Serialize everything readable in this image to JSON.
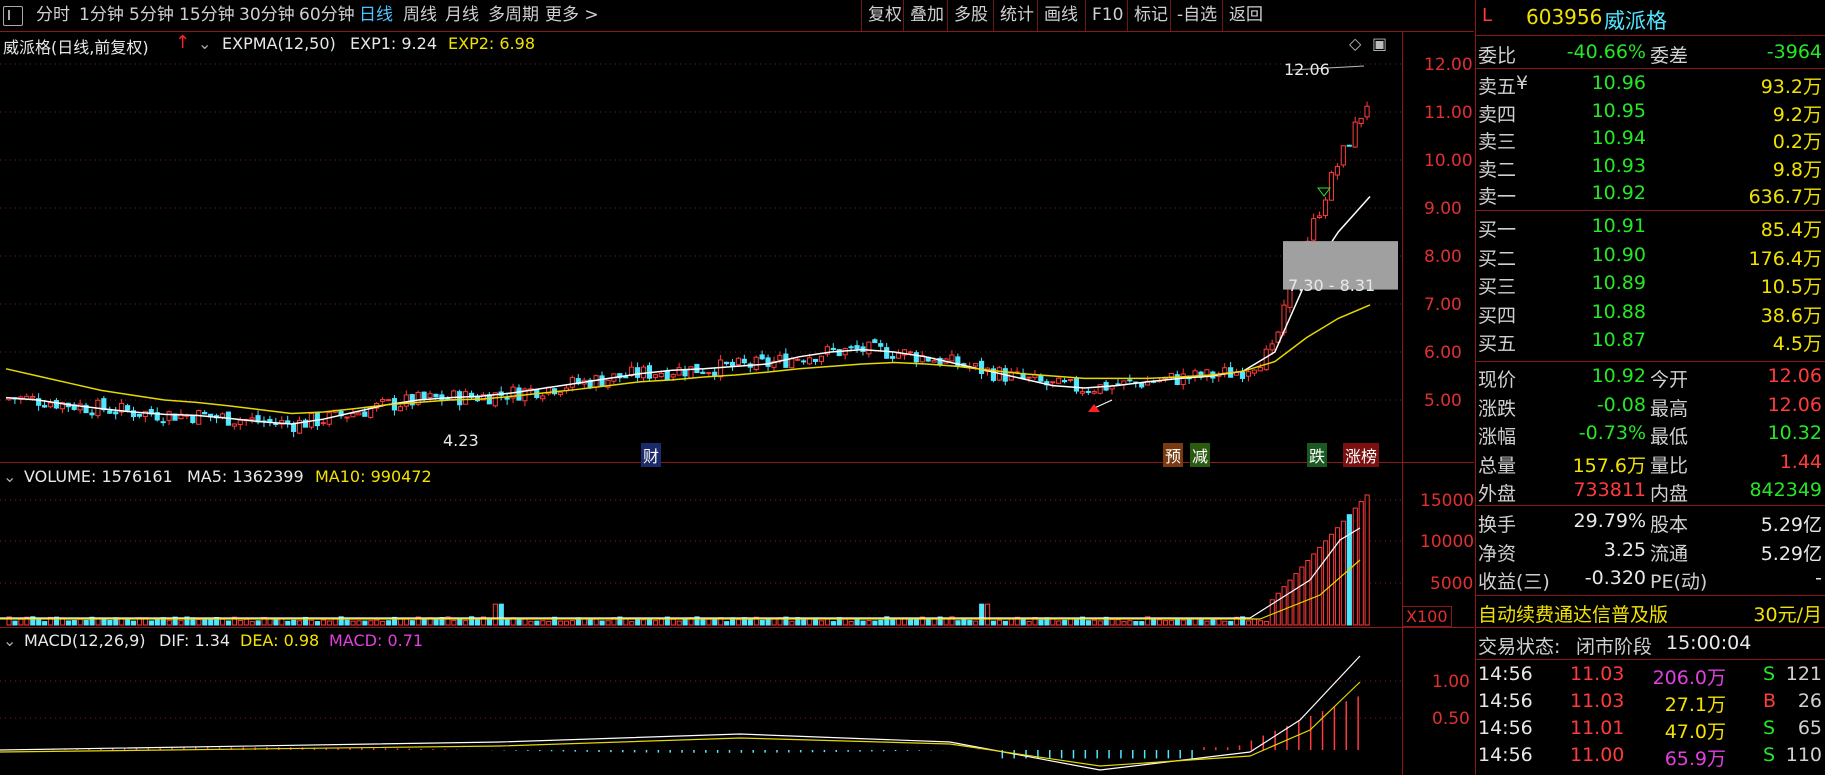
{
  "toolbar": {
    "periods": [
      "分时",
      "1分钟",
      "5分钟",
      "15分钟",
      "30分钟",
      "60分钟",
      "日线",
      "周线",
      "月线",
      "多周期",
      "更多 >"
    ],
    "active": "日线",
    "right_buttons": [
      "复权",
      "叠加",
      "多股",
      "统计",
      "画线",
      "F10",
      "标记",
      "-自选",
      "返回"
    ]
  },
  "main_chart": {
    "title": "威派格(日线,前复权)",
    "indicator": "EXPMA(12,50)",
    "exp1": "EXP1: 9.24",
    "exp2": "EXP2: 6.98",
    "y_ticks": [
      "12.00",
      "11.00",
      "10.00",
      "9.00",
      "8.00",
      "7.00",
      "6.00",
      "5.00"
    ],
    "high_label": "12.06",
    "low_label": "4.23",
    "range_label": "7.30 - 8.31",
    "events": [
      "财",
      "预",
      "减",
      "跌",
      "涨榜"
    ]
  },
  "volume_chart": {
    "label": "VOLUME: 1576161",
    "ma5": "MA5: 1362399",
    "ma10": "MA10: 990472",
    "y_ticks": [
      "15000",
      "10000",
      "5000"
    ],
    "unit": "X100"
  },
  "macd_chart": {
    "label": "MACD(12,26,9)",
    "dif": "DIF: 1.34",
    "dea": "DEA: 0.98",
    "macd": "MACD: 0.71",
    "y_ticks": [
      "1.00",
      "0.50"
    ]
  },
  "quote": {
    "code": "603956",
    "name": "威派格",
    "market_flag": "L",
    "weibi_label": "委比",
    "weibi": "-40.66%",
    "weicha_label": "委差",
    "weicha": "-3964",
    "asks": [
      {
        "label": "卖五",
        "price": "10.96",
        "vol": "93.2万"
      },
      {
        "label": "卖四",
        "price": "10.95",
        "vol": "9.2万"
      },
      {
        "label": "卖三",
        "price": "10.94",
        "vol": "0.2万"
      },
      {
        "label": "卖二",
        "price": "10.93",
        "vol": "9.8万"
      },
      {
        "label": "卖一",
        "price": "10.92",
        "vol": "636.7万"
      }
    ],
    "ask_currency": "¥",
    "bids": [
      {
        "label": "买一",
        "price": "10.91",
        "vol": "85.4万"
      },
      {
        "label": "买二",
        "price": "10.90",
        "vol": "176.4万"
      },
      {
        "label": "买三",
        "price": "10.89",
        "vol": "10.5万"
      },
      {
        "label": "买四",
        "price": "10.88",
        "vol": "38.6万"
      },
      {
        "label": "买五",
        "price": "10.87",
        "vol": "4.5万"
      }
    ],
    "stats": [
      {
        "l1": "现价",
        "v1": "10.92",
        "l2": "今开",
        "v2": "12.06"
      },
      {
        "l1": "涨跌",
        "v1": "-0.08",
        "l2": "最高",
        "v2": "12.06"
      },
      {
        "l1": "涨幅",
        "v1": "-0.73%",
        "l2": "最低",
        "v2": "10.32"
      },
      {
        "l1": "总量",
        "v1": "157.6万",
        "l2": "量比",
        "v2": "1.44"
      },
      {
        "l1": "外盘",
        "v1": "733811",
        "l2": "内盘",
        "v2": "842349"
      }
    ],
    "fund": [
      {
        "l1": "换手",
        "v1": "29.79%",
        "l2": "股本",
        "v2": "5.29亿"
      },
      {
        "l1": "净资",
        "v1": "3.25",
        "l2": "流通",
        "v2": "5.29亿"
      },
      {
        "l1": "收益(三)",
        "v1": "-0.320",
        "l2": "PE(动)",
        "v2": "-"
      }
    ],
    "promo": "自动续费通达信普及版",
    "promo_price": "30元/月",
    "trade_status_label": "交易状态:",
    "trade_status": "闭市阶段",
    "trade_time": "15:00:04",
    "ticks": [
      {
        "time": "14:56",
        "price": "11.03",
        "vol": "206.0万",
        "side": "S",
        "n": "121"
      },
      {
        "time": "14:56",
        "price": "11.03",
        "vol": "27.1万",
        "side": "B",
        "n": "26"
      },
      {
        "time": "14:56",
        "price": "11.01",
        "vol": "47.0万",
        "side": "S",
        "n": "65"
      },
      {
        "time": "14:56",
        "price": "11.00",
        "vol": "65.9万",
        "side": "S",
        "n": "110"
      }
    ]
  },
  "colors": {
    "up": "#ff3b3b",
    "down": "#4fe6ff",
    "exp1": "#ffffff",
    "exp2": "#e6d800",
    "grid": "#8a1a1a"
  },
  "chart_data": {
    "type": "candlestick",
    "series": [
      {
        "name": "EXP1",
        "values": [
          5.05,
          5.0,
          4.9,
          4.82,
          4.75,
          4.7,
          4.68,
          4.62,
          4.55,
          4.5,
          4.6,
          4.75,
          4.9,
          5.0,
          5.05,
          5.08,
          5.15,
          5.25,
          5.35,
          5.45,
          5.55,
          5.62,
          5.65,
          5.7,
          5.75,
          5.9,
          6.0,
          6.05,
          6.0,
          5.9,
          5.75,
          5.6,
          5.45,
          5.3,
          5.25,
          5.3,
          5.38,
          5.45,
          5.5,
          5.6,
          6.0,
          7.5,
          8.5,
          9.24
        ]
      },
      {
        "name": "EXP2",
        "values": [
          5.65,
          5.5,
          5.35,
          5.2,
          5.1,
          5.0,
          4.95,
          4.88,
          4.8,
          4.72,
          4.75,
          4.82,
          4.9,
          4.95,
          5.0,
          5.02,
          5.08,
          5.15,
          5.22,
          5.3,
          5.38,
          5.42,
          5.48,
          5.52,
          5.58,
          5.65,
          5.7,
          5.75,
          5.78,
          5.75,
          5.7,
          5.62,
          5.55,
          5.5,
          5.45,
          5.45,
          5.45,
          5.48,
          5.52,
          5.6,
          5.8,
          6.3,
          6.7,
          6.98
        ]
      }
    ],
    "ylim": [
      4.0,
      12.5
    ]
  }
}
